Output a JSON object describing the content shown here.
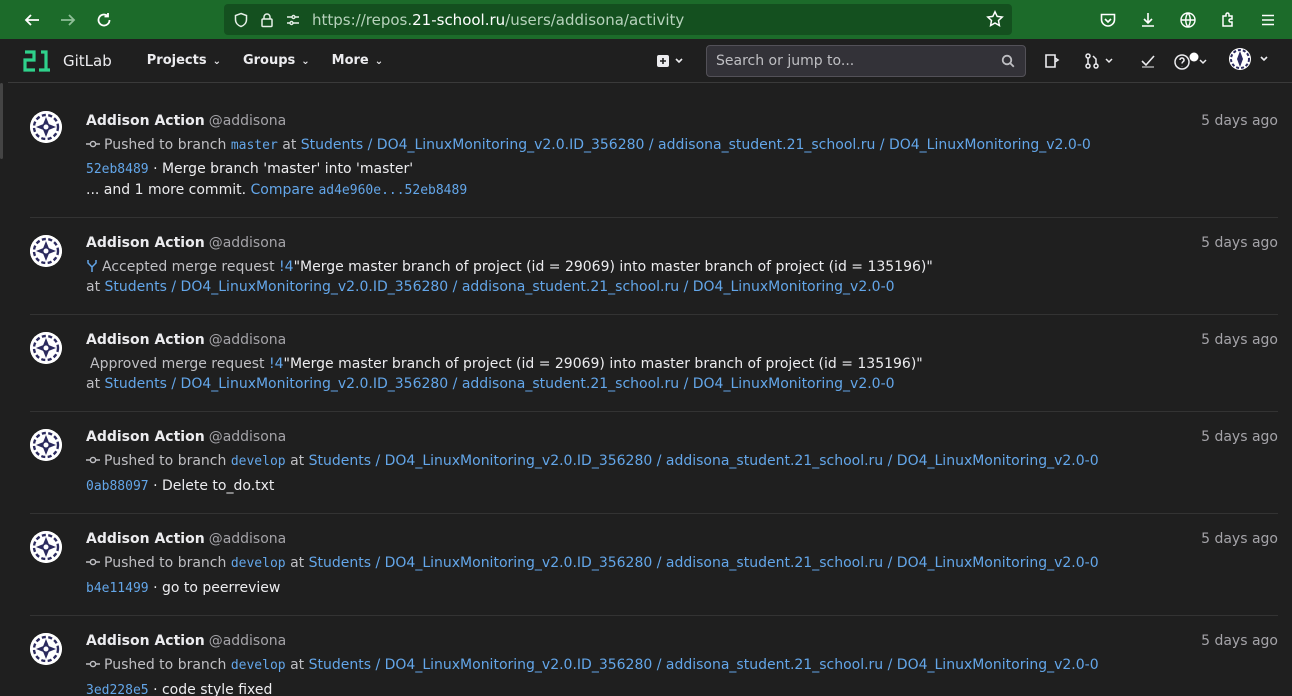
{
  "browser": {
    "url_prefix": "https://repos.",
    "url_host": "21-school.ru",
    "url_path": "/users/addisona/activity"
  },
  "header": {
    "brand": "GitLab",
    "menu": [
      "Projects",
      "Groups",
      "More"
    ],
    "search_placeholder": "Search or jump to..."
  },
  "feed": {
    "events": [
      {
        "name": "Addison Action",
        "username": "@addisona",
        "time": "5 days ago",
        "action": "Pushed to branch",
        "branch": "master",
        "at": "at",
        "project": "Students / DO4_LinuxMonitoring_v2.0.ID_356280 / addisona_student.21_school.ru / DO4_LinuxMonitoring_v2.0-0",
        "sha": "52eb8489",
        "message": "· Merge branch 'master' into 'master'",
        "more": "... and 1 more commit.",
        "compare_label": "Compare",
        "compare_range": "ad4e960e...52eb8489"
      },
      {
        "name": "Addison Action",
        "username": "@addisona",
        "time": "5 days ago",
        "action": "Accepted merge request",
        "mr": "!4",
        "mr_title": "\"Merge master branch of project (id = 29069) into master branch of project (id = 135196)\"",
        "at": "at",
        "project": "Students / DO4_LinuxMonitoring_v2.0.ID_356280 / addisona_student.21_school.ru / DO4_LinuxMonitoring_v2.0-0"
      },
      {
        "name": "Addison Action",
        "username": "@addisona",
        "time": "5 days ago",
        "action": "Approved merge request",
        "mr": "!4",
        "mr_title": "\"Merge master branch of project (id = 29069) into master branch of project (id = 135196)\"",
        "at": "at",
        "project": "Students / DO4_LinuxMonitoring_v2.0.ID_356280 / addisona_student.21_school.ru / DO4_LinuxMonitoring_v2.0-0"
      },
      {
        "name": "Addison Action",
        "username": "@addisona",
        "time": "5 days ago",
        "action": "Pushed to branch",
        "branch": "develop",
        "at": "at",
        "project": "Students / DO4_LinuxMonitoring_v2.0.ID_356280 / addisona_student.21_school.ru / DO4_LinuxMonitoring_v2.0-0",
        "sha": "0ab88097",
        "message": "· Delete to_do.txt"
      },
      {
        "name": "Addison Action",
        "username": "@addisona",
        "time": "5 days ago",
        "action": "Pushed to branch",
        "branch": "develop",
        "at": "at",
        "project": "Students / DO4_LinuxMonitoring_v2.0.ID_356280 / addisona_student.21_school.ru / DO4_LinuxMonitoring_v2.0-0",
        "sha": "b4e11499",
        "message": "· go to peerreview"
      },
      {
        "name": "Addison Action",
        "username": "@addisona",
        "time": "5 days ago",
        "action": "Pushed to branch",
        "branch": "develop",
        "at": "at",
        "project": "Students / DO4_LinuxMonitoring_v2.0.ID_356280 / addisona_student.21_school.ru / DO4_LinuxMonitoring_v2.0-0",
        "sha": "3ed228e5",
        "message": "· code style fixed"
      }
    ]
  }
}
